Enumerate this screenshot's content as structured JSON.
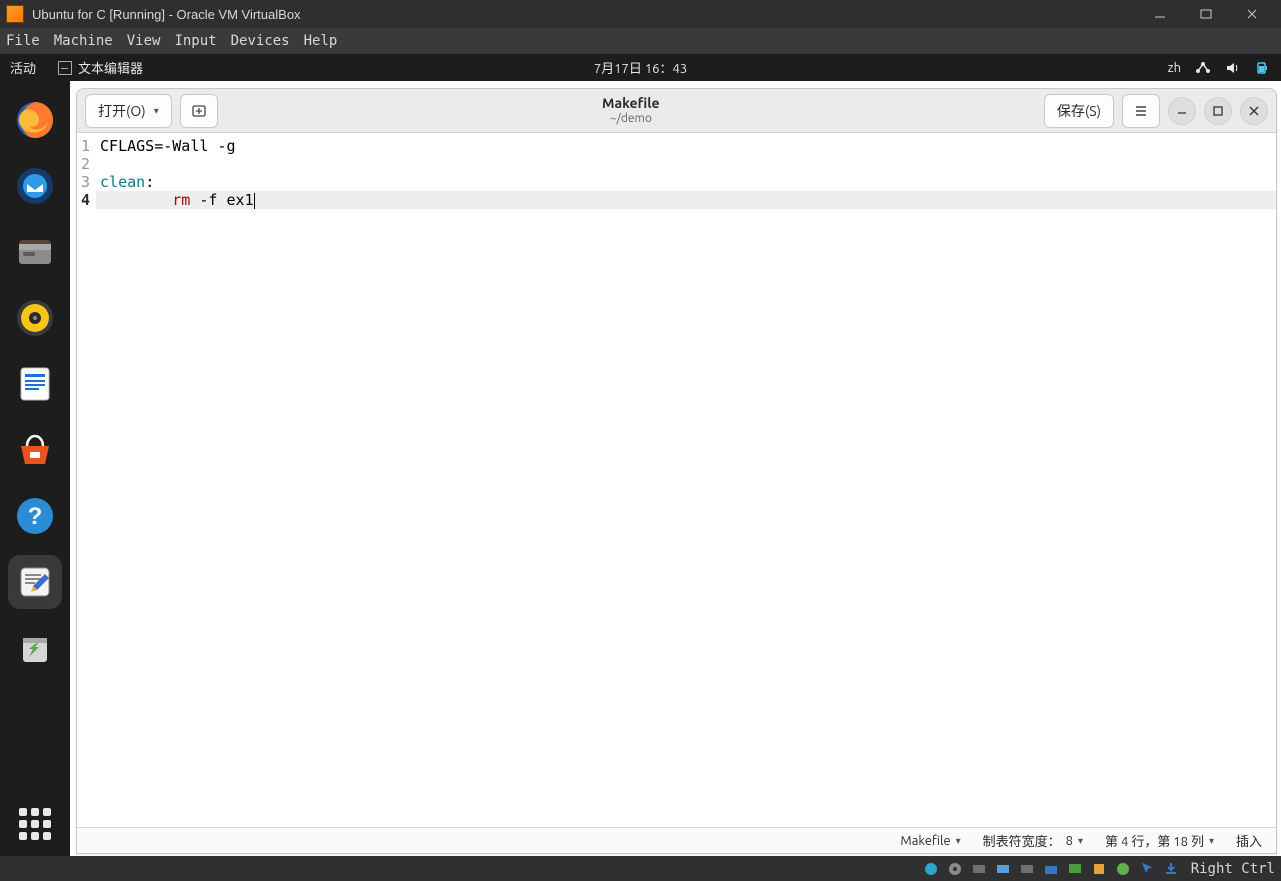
{
  "virtualbox": {
    "title": "Ubuntu for C [Running] - Oracle VM VirtualBox",
    "menu": [
      "File",
      "Machine",
      "View",
      "Input",
      "Devices",
      "Help"
    ],
    "host_key": "Right Ctrl"
  },
  "ubuntu": {
    "activities": "活动",
    "app_name": "文本编辑器",
    "clock": "7月17日  16：43",
    "ime": "zh"
  },
  "editor": {
    "open_btn": "打开(O)",
    "save_btn": "保存(S)",
    "title": "Makefile",
    "subtitle": "~/demo",
    "lines": [
      {
        "n": "1",
        "tokens": [
          {
            "t": "plain",
            "s": "CFLAGS=-Wall -g"
          }
        ]
      },
      {
        "n": "2",
        "tokens": []
      },
      {
        "n": "3",
        "tokens": [
          {
            "t": "kw",
            "s": "clean"
          },
          {
            "t": "plain",
            "s": ":"
          }
        ]
      },
      {
        "n": "4",
        "hl": true,
        "cursor": true,
        "tokens": [
          {
            "t": "plain",
            "s": "        "
          },
          {
            "t": "cmd",
            "s": "rm"
          },
          {
            "t": "plain",
            "s": " -f ex1"
          }
        ]
      }
    ],
    "status": {
      "lang": "Makefile",
      "tab_width_label": "制表符宽度：",
      "tab_width_value": "8",
      "line_col": "第 4 行，第 18 列",
      "insert": "插入"
    }
  }
}
